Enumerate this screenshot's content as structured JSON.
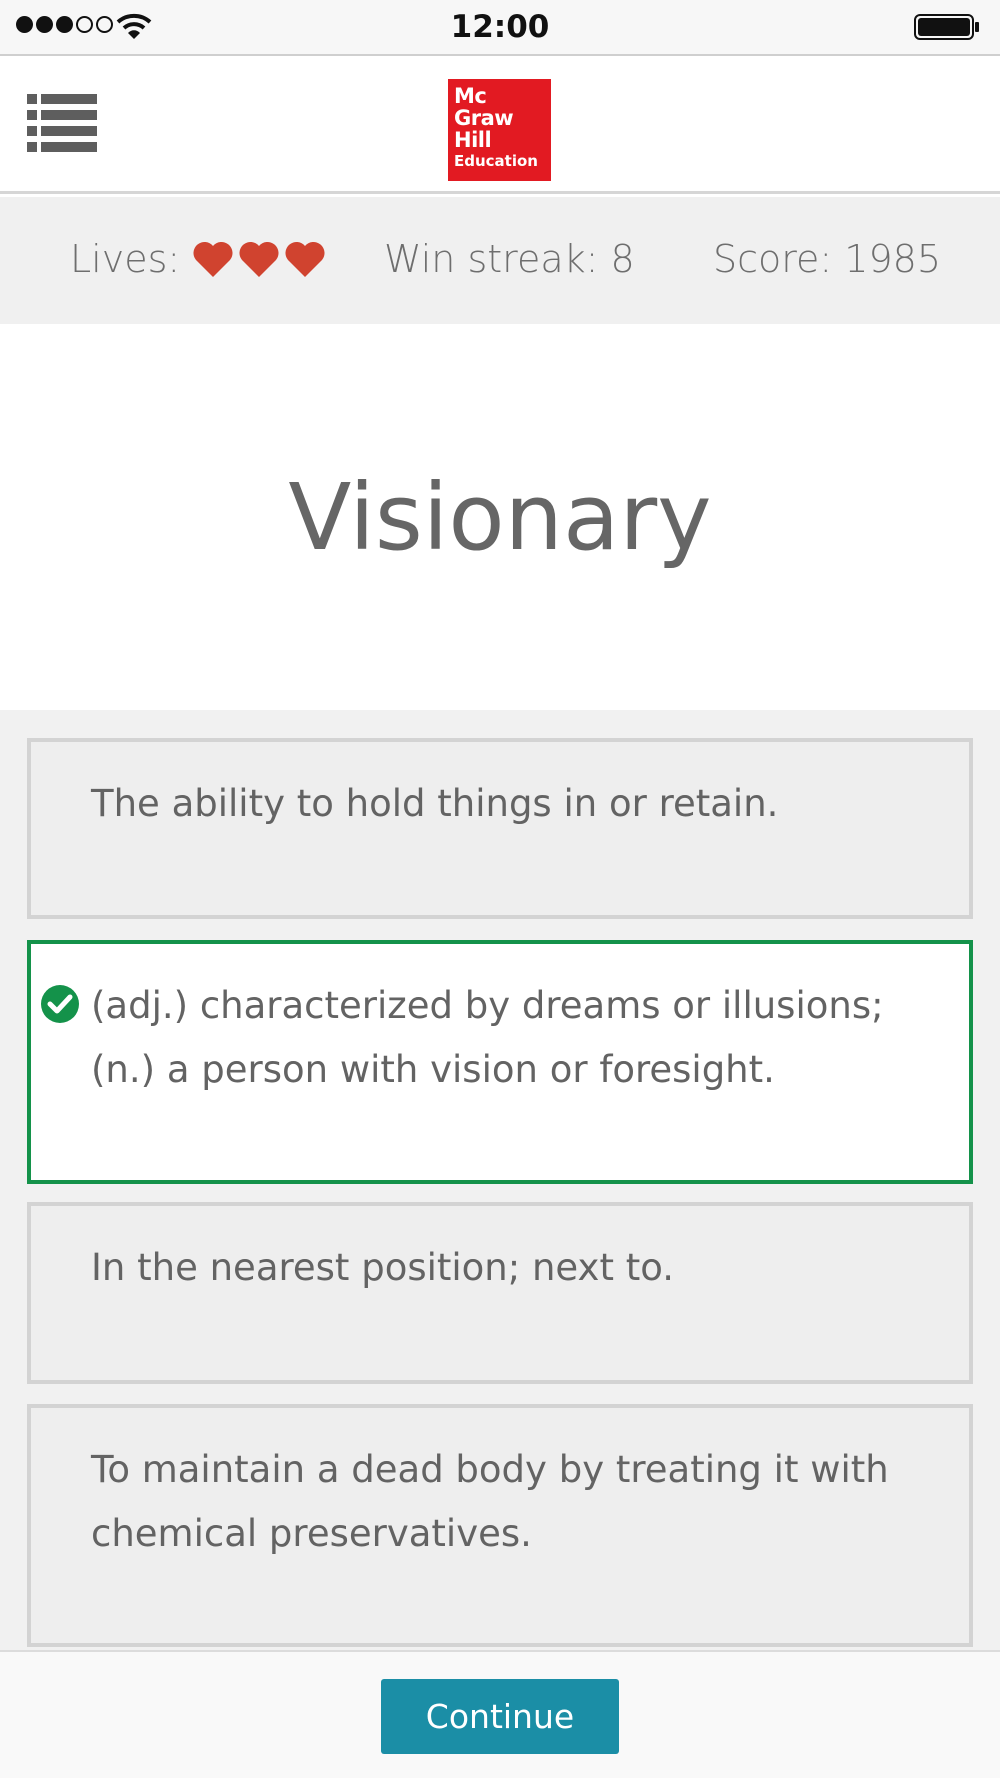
{
  "status_bar": {
    "time": "12:00",
    "signal_bars": 5,
    "signal_filled": 3
  },
  "header": {
    "menu_icon": "list-icon",
    "logo_lines": [
      "Mc",
      "Graw",
      "Hill",
      "Education"
    ],
    "logo_color": "#e21a22"
  },
  "stats": {
    "lives_label": "Lives:",
    "lives_count": 3,
    "heart_color": "#d0432f",
    "win_streak": "Win streak: 8",
    "score": "Score: 1985"
  },
  "question": {
    "word": "Visionary"
  },
  "options": [
    {
      "text": "The ability to hold things in or retain.",
      "state": "default"
    },
    {
      "text": "(adj.) characterized by dreams or illusions; (n.) a person with vision or foresight.",
      "state": "correct"
    },
    {
      "text": "In the nearest position; next to.",
      "state": "default"
    },
    {
      "text": "To maintain a dead body by treating it with chemical preservatives.",
      "state": "default"
    }
  ],
  "footer": {
    "continue_label": "Continue",
    "button_color": "#1b8ea6"
  },
  "colors": {
    "correct_border": "#14924a"
  }
}
